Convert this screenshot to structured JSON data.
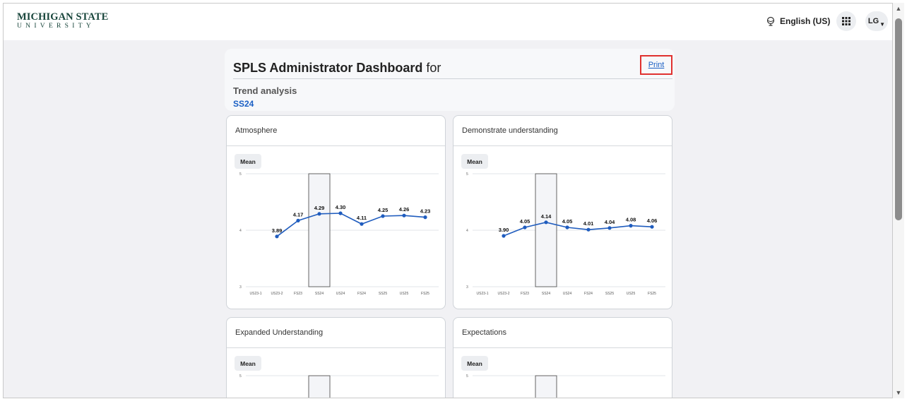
{
  "header": {
    "logo_line1": "MICHIGAN STATE",
    "logo_line2": "UNIVERSITY",
    "language": "English (US)",
    "user_initials": "LG"
  },
  "dashboard": {
    "title_bold": "SPLS Administrator Dashboard",
    "title_rest": "for",
    "print_label": "Print",
    "subtitle": "Trend analysis",
    "term": "SS24"
  },
  "cards": [
    {
      "title": "Atmosphere",
      "pill": "Mean"
    },
    {
      "title": "Demonstrate understanding",
      "pill": "Mean"
    },
    {
      "title": "Expanded Understanding",
      "pill": "Mean"
    },
    {
      "title": "Expectations",
      "pill": "Mean"
    }
  ],
  "chart_data": [
    {
      "type": "line",
      "title": "Atmosphere",
      "x": [
        "US23-1",
        "US23-2",
        "FS23",
        "SS24",
        "US24",
        "FS24",
        "SS25",
        "US25",
        "FS25"
      ],
      "series": [
        {
          "values": [
            null,
            3.89,
            4.17,
            4.29,
            4.3,
            4.11,
            4.25,
            4.26,
            4.23
          ]
        }
      ],
      "data_labels": [
        null,
        "3.89",
        "4.17",
        "4.29",
        "4.30",
        "4.11",
        "4.25",
        "4.26",
        "4.23"
      ],
      "y_ticks": [
        "5",
        "4",
        "3"
      ],
      "ylim": [
        3,
        5
      ],
      "highlight": "SS24",
      "color": "#1f5cbe"
    },
    {
      "type": "line",
      "title": "Demonstrate understanding",
      "x": [
        "US23-1",
        "US23-2",
        "FS23",
        "SS24",
        "US24",
        "FS24",
        "SS25",
        "US25",
        "FS25"
      ],
      "series": [
        {
          "values": [
            null,
            3.9,
            4.05,
            4.14,
            4.05,
            4.01,
            4.04,
            4.08,
            4.06
          ]
        }
      ],
      "data_labels": [
        null,
        "3.90",
        "4.05",
        "4.14",
        "4.05",
        "4.01",
        "4.04",
        "4.08",
        "4.06"
      ],
      "y_ticks": [
        "5",
        "4",
        "3"
      ],
      "ylim": [
        3,
        5
      ],
      "highlight": "SS24",
      "color": "#1f5cbe"
    },
    {
      "type": "line",
      "title": "Expanded Understanding",
      "y_ticks": [
        "5"
      ],
      "ylim": [
        3,
        5
      ],
      "highlight": "SS24"
    },
    {
      "type": "line",
      "title": "Expectations",
      "y_ticks": [
        "5"
      ],
      "ylim": [
        3,
        5
      ],
      "highlight": "SS24"
    }
  ]
}
